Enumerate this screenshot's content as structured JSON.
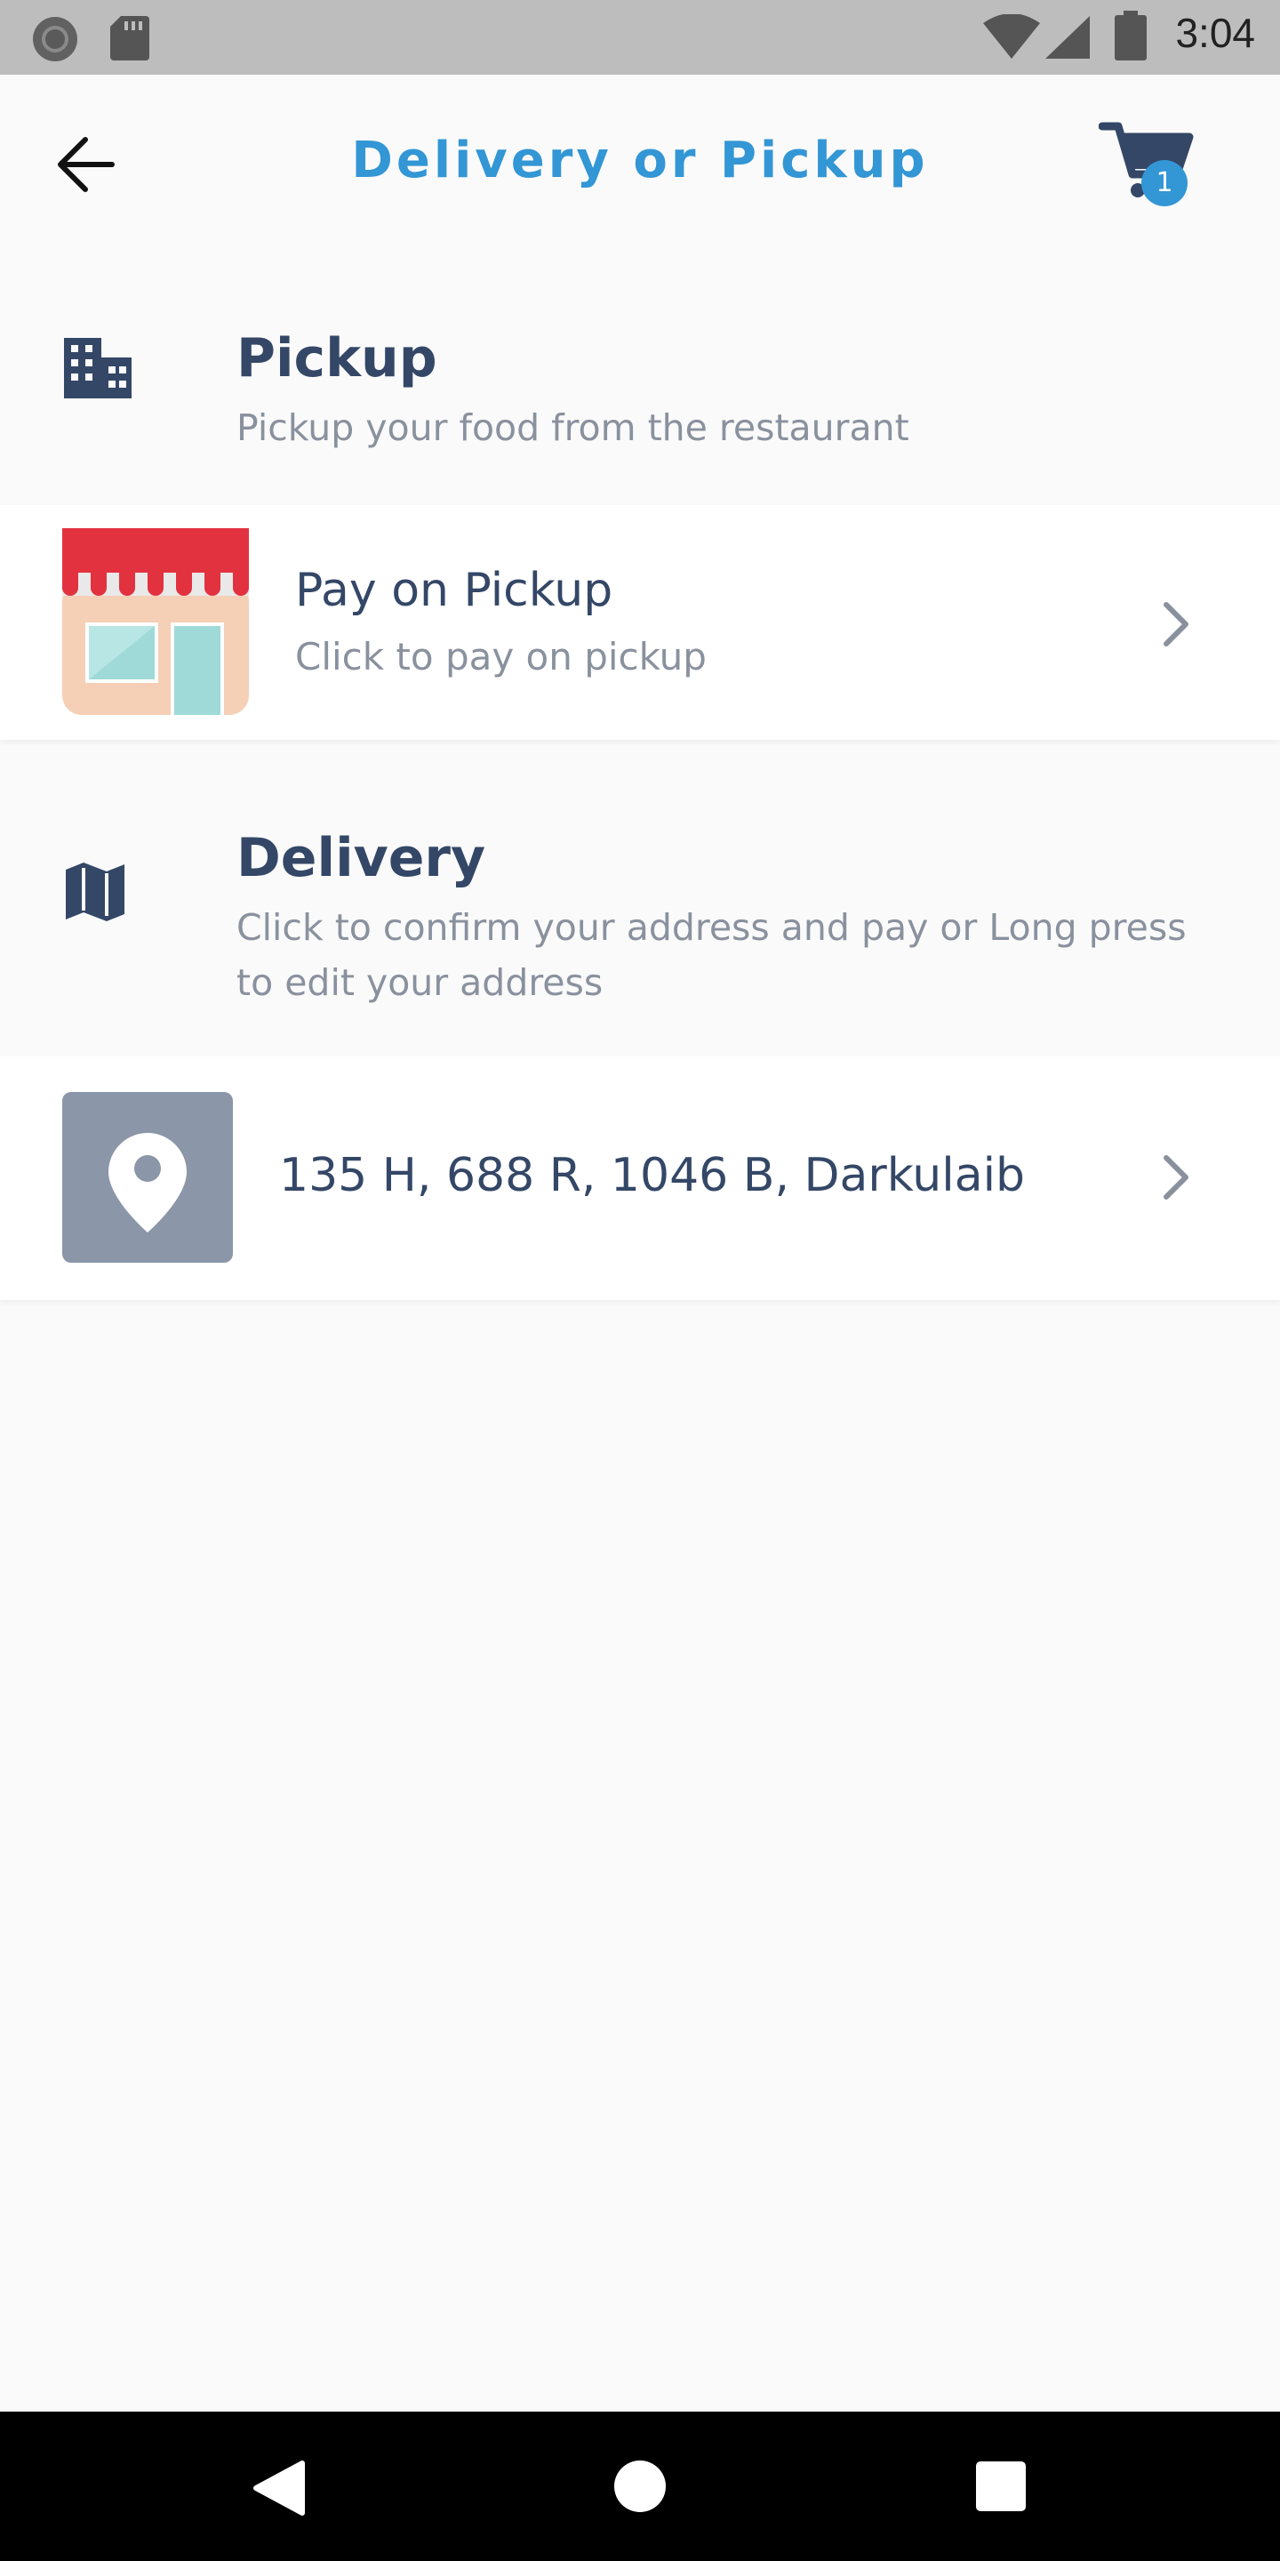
{
  "status_bar": {
    "time": "3:04"
  },
  "header": {
    "title": "Delivery or Pickup",
    "cart_count": "1"
  },
  "pickup_section": {
    "title": "Pickup",
    "subtitle": "Pickup your food from the restaurant"
  },
  "pay_on_pickup": {
    "title": "Pay on Pickup",
    "subtitle": "Click to pay on pickup"
  },
  "delivery_section": {
    "title": "Delivery",
    "subtitle": "Click to confirm your address and pay or Long press to edit your address"
  },
  "address": {
    "text": "135 H, 688 R, 1046 B, Darkulaib"
  },
  "colors": {
    "accent": "#3396d5",
    "text_primary": "#344767",
    "text_secondary": "#8a919e",
    "background": "#fafafa"
  }
}
